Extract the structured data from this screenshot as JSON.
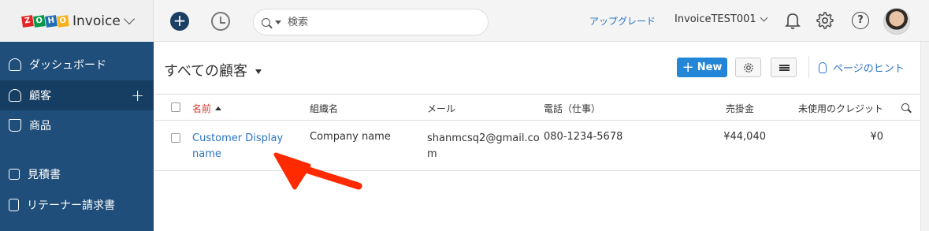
{
  "brand": {
    "logo_letters": [
      "Z",
      "O",
      "H",
      "O"
    ],
    "logo_colors": [
      "#e42527",
      "#089949",
      "#226db4",
      "#f9b21d"
    ],
    "product": "Invoice"
  },
  "topbar": {
    "add_icon": "plus",
    "history_icon": "history-clock",
    "search_placeholder": "検索",
    "upgrade_label": "アップグレード",
    "org_name": "InvoiceTEST001",
    "help_symbol": "?"
  },
  "sidebar": {
    "items": [
      {
        "label": "ダッシュボード",
        "icon": "dashboard-icon"
      },
      {
        "label": "顧客",
        "icon": "user-icon",
        "active": true,
        "action": "+"
      },
      {
        "label": "商品",
        "icon": "basket-icon"
      },
      {
        "label": "見積書",
        "icon": "quote-icon"
      },
      {
        "label": "リテーナー請求書",
        "icon": "retainer-icon"
      }
    ]
  },
  "main": {
    "title": "すべての顧客",
    "new_label": "New",
    "hint_label": "ページのヒント",
    "columns": [
      "名前",
      "組織名",
      "メール",
      "電話（仕事）",
      "売掛金",
      "未使用のクレジット"
    ],
    "rows": [
      {
        "name_line1": "Customer Display",
        "name_line2": "name",
        "company": "Company name",
        "email_line1": "shanmcsq2@gmail.co",
        "email_line2": "m",
        "phone": "080-1234-5678",
        "receivables": "¥44,040",
        "credits": "¥0"
      }
    ]
  },
  "colors": {
    "sidebar": "#1f4e7a",
    "sidebar_active": "#163d62",
    "accent": "#2386d6",
    "link": "#2a74c4",
    "sorted_header": "#d9342b",
    "annotation_arrow": "#ff2a00"
  }
}
